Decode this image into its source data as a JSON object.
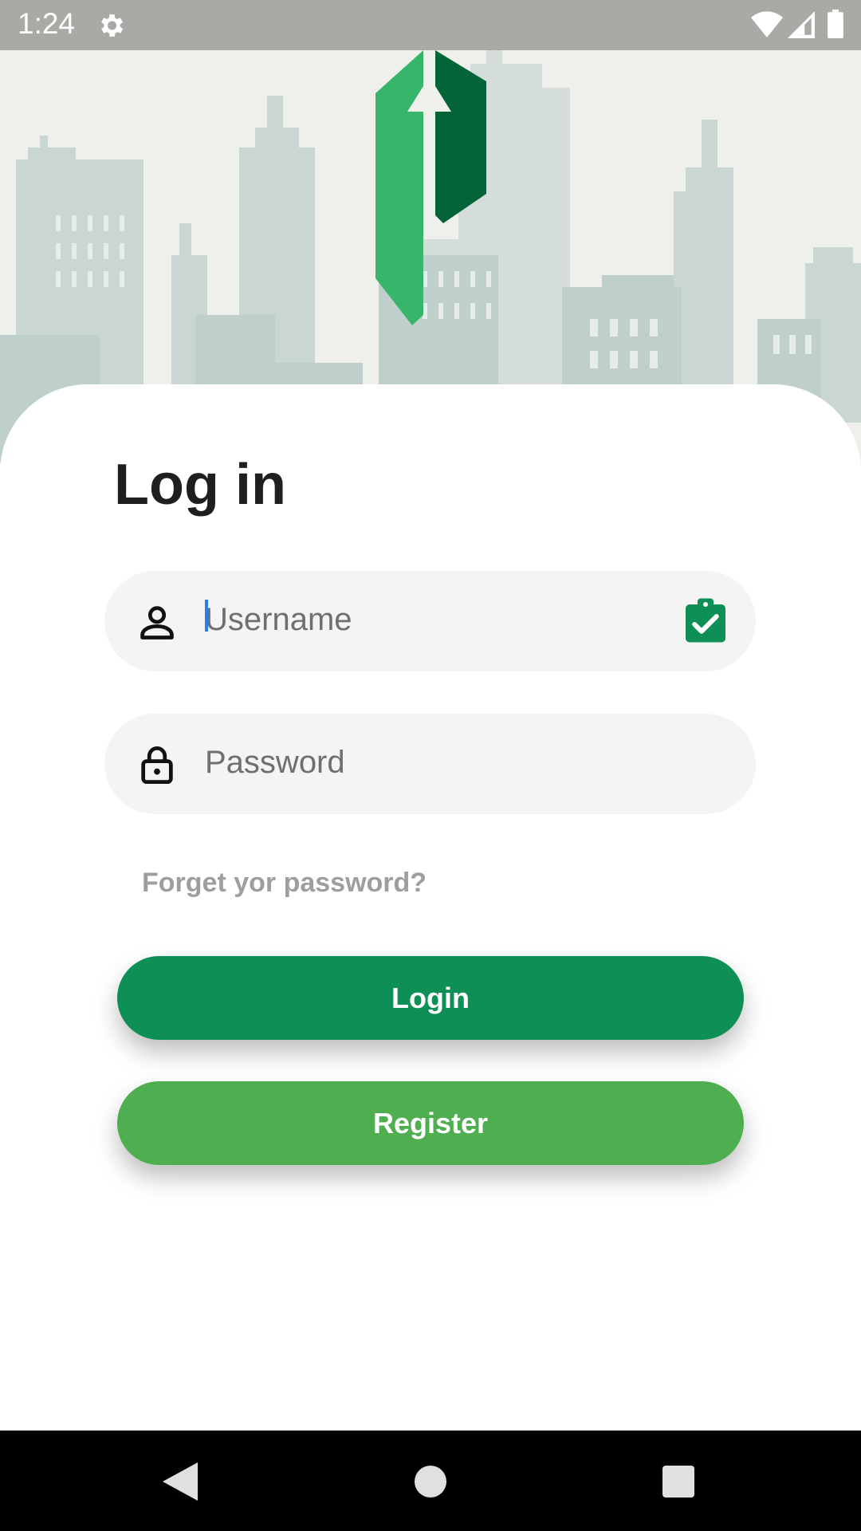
{
  "status_bar": {
    "time": "1:24",
    "icons": [
      "gear-icon",
      "wifi-icon",
      "cell-signal-icon",
      "battery-icon"
    ]
  },
  "header": {
    "logo": "brand-logo",
    "background": "city-skyline-illustration"
  },
  "login": {
    "title": "Log in",
    "username": {
      "placeholder": "Username",
      "value": "",
      "icon": "person-icon",
      "trailing_icon": "clipboard-check-icon"
    },
    "password": {
      "placeholder": "Password",
      "value": "",
      "icon": "lock-icon"
    },
    "forgot_label": "Forget yor password?",
    "login_label": "Login",
    "register_label": "Register"
  },
  "nav_bar": {
    "icons": [
      "back-icon",
      "home-icon",
      "recents-icon"
    ]
  },
  "colors": {
    "login_button": "#0e8f55",
    "register_button": "#4faf50",
    "logo_light": "#36b56b",
    "logo_dark": "#036438",
    "field_bg": "#f4f4f4"
  }
}
